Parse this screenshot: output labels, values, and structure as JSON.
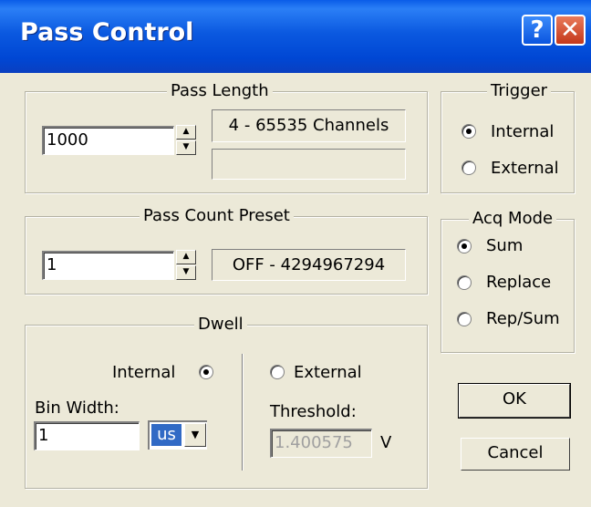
{
  "window": {
    "title": "Pass Control",
    "help_symbol": "?",
    "close_symbol": "✕"
  },
  "pass_length": {
    "legend": "Pass Length",
    "value": "1000",
    "range": "4 - 65535 Channels",
    "info": ""
  },
  "pass_count": {
    "legend": "Pass Count Preset",
    "value": "1",
    "range": "OFF - 4294967294"
  },
  "dwell": {
    "legend": "Dwell",
    "internal_label": "Internal",
    "internal_checked": true,
    "external_label": "External",
    "external_checked": false,
    "bin_width_label": "Bin Width:",
    "bin_width_value": "1",
    "unit_value": "us",
    "threshold_label": "Threshold:",
    "threshold_value": "1.400575",
    "threshold_unit": "V"
  },
  "trigger": {
    "legend": "Trigger",
    "options": [
      {
        "label": "Internal",
        "checked": true
      },
      {
        "label": "External",
        "checked": false
      }
    ]
  },
  "acq_mode": {
    "legend": "Acq Mode",
    "options": [
      {
        "label": "Sum",
        "checked": true
      },
      {
        "label": "Replace",
        "checked": false
      },
      {
        "label": "Rep/Sum",
        "checked": false
      }
    ]
  },
  "buttons": {
    "ok": "OK",
    "cancel": "Cancel"
  },
  "icons": {
    "spin_up": "▲",
    "spin_down": "▼",
    "dropdown": "▼"
  }
}
